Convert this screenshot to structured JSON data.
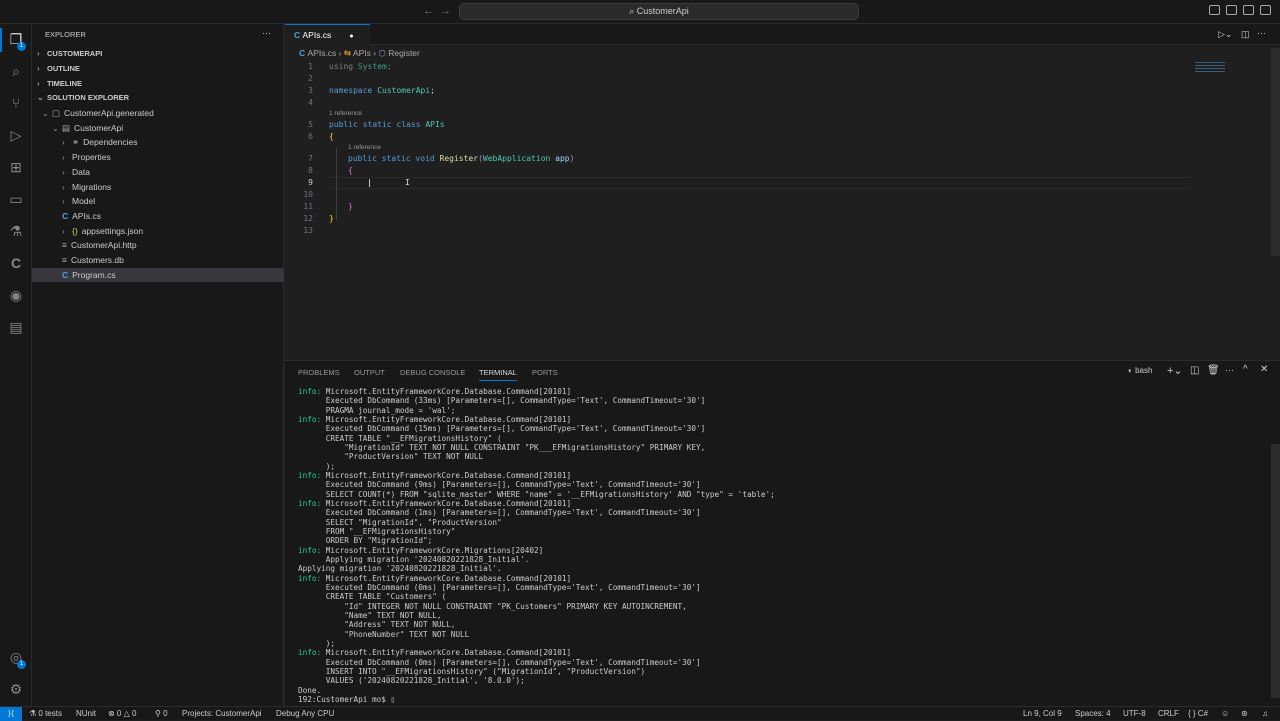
{
  "titlebar": {
    "search": "CustomerApi",
    "search_icon": "search-icon"
  },
  "activity": {
    "explorer_badge": "1",
    "accounts_badge": "1"
  },
  "sidebar": {
    "title": "EXPLORER",
    "more": "···",
    "sections": [
      "CUSTOMERAPI",
      "OUTLINE",
      "TIMELINE",
      "SOLUTION EXPLORER"
    ],
    "tree": [
      {
        "label": "CustomerApi.generated",
        "level": 1,
        "chev": "⌄",
        "icon": "▢"
      },
      {
        "label": "CustomerApi",
        "level": 2,
        "chev": "⌄",
        "icon": "▤"
      },
      {
        "label": "Dependencies",
        "level": 3,
        "chev": "›",
        "icon": "⚭"
      },
      {
        "label": "Properties",
        "level": 3,
        "chev": "›",
        "icon": ""
      },
      {
        "label": "Data",
        "level": 3,
        "chev": "›",
        "icon": ""
      },
      {
        "label": "Migrations",
        "level": 3,
        "chev": "›",
        "icon": ""
      },
      {
        "label": "Model",
        "level": 3,
        "chev": "›",
        "icon": ""
      },
      {
        "label": "APIs.cs",
        "level": 3,
        "chev": "",
        "icon": "C"
      },
      {
        "label": "appsettings.json",
        "level": 3,
        "chev": "›",
        "icon": "{}"
      },
      {
        "label": "CustomerApi.http",
        "level": 3,
        "chev": "",
        "icon": "≡"
      },
      {
        "label": "Customers.db",
        "level": 3,
        "chev": "",
        "icon": "≡"
      },
      {
        "label": "Program.cs",
        "level": 3,
        "chev": "",
        "icon": "C"
      }
    ]
  },
  "editor": {
    "tab": "APIs.cs",
    "modified_dot": "●",
    "breadcrumb": [
      "APIs.cs",
      "APIs",
      "Register"
    ],
    "reference": "1 reference",
    "line_numbers": [
      "1",
      "2",
      "3",
      "4",
      "5",
      "6",
      "7",
      "8",
      "9",
      "10",
      "11",
      "12",
      "13"
    ],
    "code": {
      "l1a": "using",
      "l1b": "System",
      "l3a": "namespace",
      "l3b": "CustomerApi",
      "l5a": "public static class",
      "l5b": "APIs",
      "l7a": "public static void",
      "l7b": "Register",
      "l7c": "WebApplication",
      "l7d": "app"
    }
  },
  "panel": {
    "tabs": [
      "PROBLEMS",
      "OUTPUT",
      "DEBUG CONSOLE",
      "TERMINAL",
      "PORTS"
    ],
    "active_tab": "TERMINAL",
    "shell": "bash",
    "terminal": [
      [
        "info:",
        " Microsoft.EntityFrameworkCore.Database.Command[20101]"
      ],
      [
        "",
        "      Executed DbCommand (33ms) [Parameters=[], CommandType='Text', CommandTimeout='30']"
      ],
      [
        "",
        "      PRAGMA journal_mode = 'wal';"
      ],
      [
        "info:",
        " Microsoft.EntityFrameworkCore.Database.Command[20101]"
      ],
      [
        "",
        "      Executed DbCommand (15ms) [Parameters=[], CommandType='Text', CommandTimeout='30']"
      ],
      [
        "",
        "      CREATE TABLE \"__EFMigrationsHistory\" ("
      ],
      [
        "",
        "          \"MigrationId\" TEXT NOT NULL CONSTRAINT \"PK___EFMigrationsHistory\" PRIMARY KEY,"
      ],
      [
        "",
        "          \"ProductVersion\" TEXT NOT NULL"
      ],
      [
        "",
        "      );"
      ],
      [
        "info:",
        " Microsoft.EntityFrameworkCore.Database.Command[20101]"
      ],
      [
        "",
        "      Executed DbCommand (9ms) [Parameters=[], CommandType='Text', CommandTimeout='30']"
      ],
      [
        "",
        "      SELECT COUNT(*) FROM \"sqlite_master\" WHERE \"name\" = '__EFMigrationsHistory' AND \"type\" = 'table';"
      ],
      [
        "info:",
        " Microsoft.EntityFrameworkCore.Database.Command[20101]"
      ],
      [
        "",
        "      Executed DbCommand (1ms) [Parameters=[], CommandType='Text', CommandTimeout='30']"
      ],
      [
        "",
        "      SELECT \"MigrationId\", \"ProductVersion\""
      ],
      [
        "",
        "      FROM \"__EFMigrationsHistory\""
      ],
      [
        "",
        "      ORDER BY \"MigrationId\";"
      ],
      [
        "info:",
        " Microsoft.EntityFrameworkCore.Migrations[20402]"
      ],
      [
        "",
        "      Applying migration '20240820221828_Initial'."
      ],
      [
        "",
        "Applying migration '20240820221828_Initial'."
      ],
      [
        "info:",
        " Microsoft.EntityFrameworkCore.Database.Command[20101]"
      ],
      [
        "",
        "      Executed DbCommand (0ms) [Parameters=[], CommandType='Text', CommandTimeout='30']"
      ],
      [
        "",
        "      CREATE TABLE \"Customers\" ("
      ],
      [
        "",
        "          \"Id\" INTEGER NOT NULL CONSTRAINT \"PK_Customers\" PRIMARY KEY AUTOINCREMENT,"
      ],
      [
        "",
        "          \"Name\" TEXT NOT NULL,"
      ],
      [
        "",
        "          \"Address\" TEXT NOT NULL,"
      ],
      [
        "",
        "          \"PhoneNumber\" TEXT NOT NULL"
      ],
      [
        "",
        "      );"
      ],
      [
        "info:",
        " Microsoft.EntityFrameworkCore.Database.Command[20101]"
      ],
      [
        "",
        "      Executed DbCommand (0ms) [Parameters=[], CommandType='Text', CommandTimeout='30']"
      ],
      [
        "",
        "      INSERT INTO \"__EFMigrationsHistory\" (\"MigrationId\", \"ProductVersion\")"
      ],
      [
        "",
        "      VALUES ('20240820221828_Initial', '8.0.0');"
      ],
      [
        "",
        "Done."
      ],
      [
        "",
        "192:CustomerApi mo$ ▯"
      ]
    ]
  },
  "status": {
    "tests": "0 tests",
    "nunit": "NUnit",
    "problems": "⊗ 0 △ 0",
    "ports": "⚲ 0",
    "projects": "Projects: CustomerApi",
    "debug": "Debug Any CPU",
    "position": "Ln 9, Col 9",
    "spaces": "Spaces: 4",
    "encoding": "UTF-8",
    "eol": "CRLF",
    "language": "{ } C#"
  }
}
